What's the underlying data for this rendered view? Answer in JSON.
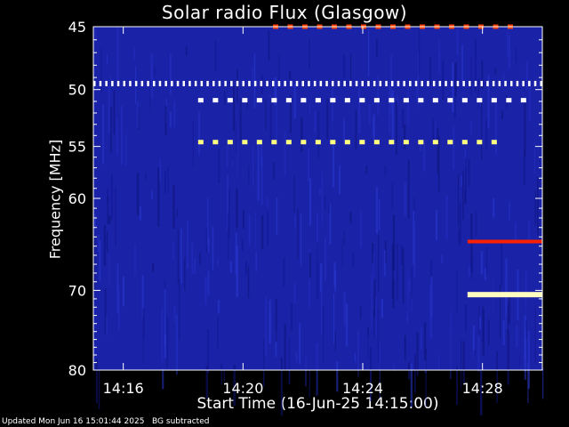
{
  "chart_data": {
    "type": "heatmap",
    "title": "Solar radio Flux (Glasgow)",
    "xlabel": "Start Time (16-Jun-25 14:15:00)",
    "ylabel": "Frequency [MHz]",
    "x_range_minutes": [
      "14:15:00",
      "14:30:00"
    ],
    "x_ticks": [
      "14:16",
      "14:20",
      "14:24",
      "14:28"
    ],
    "y_ticks": [
      45,
      50,
      55,
      60,
      70,
      80
    ],
    "y_range": [
      45,
      80
    ],
    "y_scale": "log",
    "background_color": "#1a22a8",
    "features": [
      {
        "name": "pulsed interference",
        "frequency_mhz": 49.5,
        "start": "14:15",
        "end": "14:30",
        "color": "#ffffff"
      },
      {
        "name": "pulsed interference",
        "frequency_mhz": 50.9,
        "start": "14:18.5",
        "end": "14:29.7",
        "color": "#ffffff"
      },
      {
        "name": "pulsed interference",
        "frequency_mhz": 54.6,
        "start": "14:18.5",
        "end": "14:28.5",
        "color": "#ffff80"
      },
      {
        "name": "pulsed interference",
        "frequency_mhz": 45.0,
        "start": "14:21",
        "end": "14:29",
        "color": "#ff4000"
      },
      {
        "name": "continuous interference",
        "frequency_mhz": 64.5,
        "start": "14:27.5",
        "end": "14:30",
        "color": "#ff2000"
      },
      {
        "name": "continuous interference",
        "frequency_mhz": 70.5,
        "start": "14:27.5",
        "end": "14:30",
        "color": "#ffffc0"
      }
    ]
  },
  "footer": {
    "updated": "Updated Mon Jun 16 15:01:44 2025",
    "note": "BG subtracted"
  },
  "colors": {
    "background": "#000000",
    "plot_bg": "#1a22a8",
    "foreground": "#ffffff"
  }
}
